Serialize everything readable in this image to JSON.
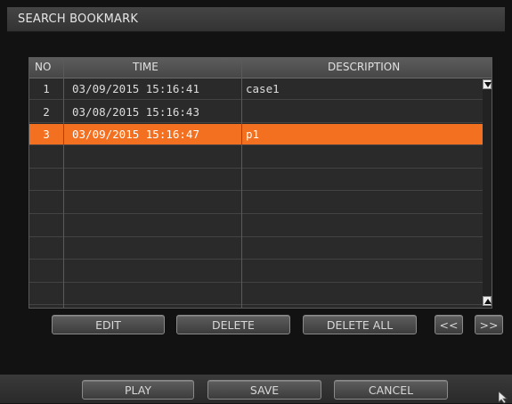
{
  "window": {
    "title": "SEARCH BOOKMARK"
  },
  "table": {
    "headers": {
      "no": "NO",
      "time": "TIME",
      "description": "DESCRIPTION"
    },
    "rows": [
      {
        "no": "1",
        "time": "03/09/2015  15:16:41",
        "description": "case1",
        "selected": false
      },
      {
        "no": "2",
        "time": "03/08/2015  15:16:43",
        "description": "",
        "selected": false
      },
      {
        "no": "3",
        "time": "03/09/2015  15:16:47",
        "description": "p1",
        "selected": true
      },
      {
        "no": "",
        "time": "",
        "description": "",
        "selected": false
      },
      {
        "no": "",
        "time": "",
        "description": "",
        "selected": false
      },
      {
        "no": "",
        "time": "",
        "description": "",
        "selected": false
      },
      {
        "no": "",
        "time": "",
        "description": "",
        "selected": false
      },
      {
        "no": "",
        "time": "",
        "description": "",
        "selected": false
      },
      {
        "no": "",
        "time": "",
        "description": "",
        "selected": false
      },
      {
        "no": "",
        "time": "",
        "description": "",
        "selected": false
      }
    ],
    "scroll_up_icon": "triangle-up-icon",
    "scroll_down_icon": "triangle-down-icon"
  },
  "actions": {
    "edit": "EDIT",
    "delete": "DELETE",
    "delete_all": "DELETE ALL",
    "prev_page": "<<",
    "next_page": ">>"
  },
  "footer": {
    "play": "PLAY",
    "save": "SAVE",
    "cancel": "CANCEL"
  },
  "colors": {
    "selection": "#f37021",
    "background": "#121212"
  }
}
